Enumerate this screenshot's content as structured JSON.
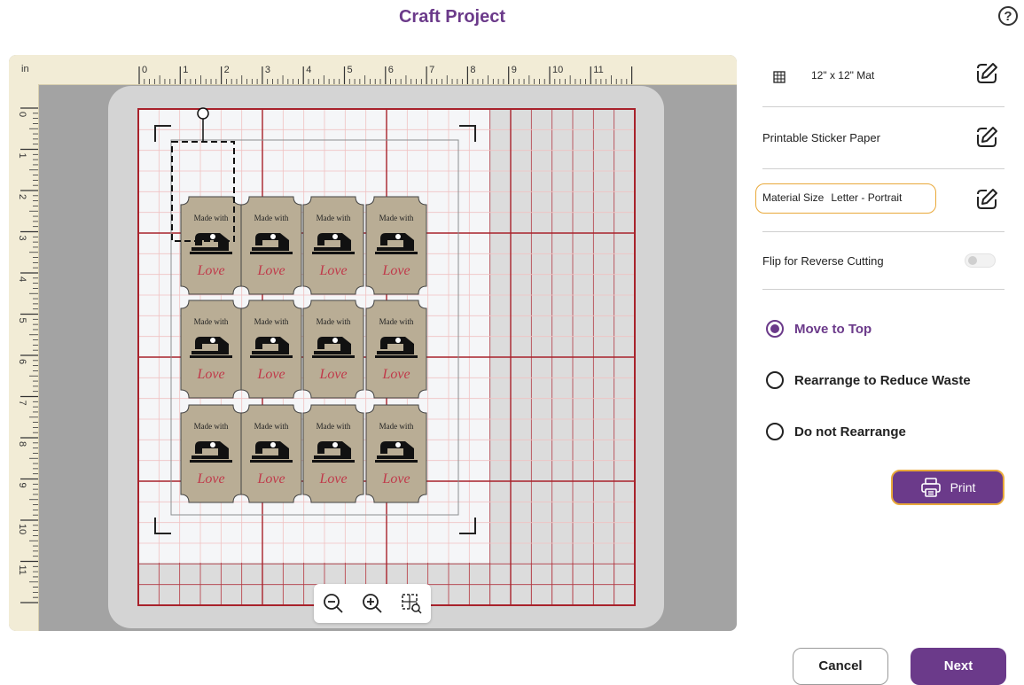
{
  "header": {
    "title": "Craft Project",
    "help_glyph": "?"
  },
  "canvas": {
    "ruler_unit": "in",
    "ruler_top_numbers": [
      "0",
      "1",
      "2",
      "3",
      "4",
      "5",
      "6",
      "7",
      "8",
      "9",
      "10",
      "11"
    ],
    "ruler_left_numbers": [
      "0",
      "1",
      "2",
      "3",
      "4",
      "5",
      "6",
      "7",
      "8",
      "9",
      "10",
      "11"
    ],
    "sticker": {
      "line1": "Made with",
      "line2": "Love",
      "rows": 3,
      "cols": 4,
      "fill_color": "#b9ad95",
      "love_color": "#c0394a"
    },
    "zoom_tools": [
      {
        "name": "zoom-out-icon"
      },
      {
        "name": "zoom-in-icon"
      },
      {
        "name": "zoom-fit-icon"
      }
    ]
  },
  "panel": {
    "mat_label": "12\" x 12\" Mat",
    "material_label": "Printable Sticker Paper",
    "material_size_label": "Material Size",
    "material_size_value": "Letter - Portrait",
    "flip_label": "Flip for Reverse Cutting",
    "flip_on": false,
    "arrange_options": [
      {
        "label": "Move to Top",
        "selected": true
      },
      {
        "label": "Rearrange to Reduce Waste",
        "selected": false
      },
      {
        "label": "Do not Rearrange",
        "selected": false
      }
    ],
    "print_label": "Print"
  },
  "footer": {
    "cancel_label": "Cancel",
    "next_label": "Next"
  },
  "colors": {
    "accent": "#6b3a8a",
    "highlight": "#e9a93a",
    "grid_line": "#f0c2c2",
    "grid_border": "#a8222b"
  }
}
